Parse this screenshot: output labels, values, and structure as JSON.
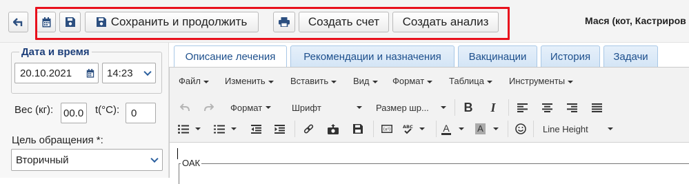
{
  "toolbar": {
    "save_continue_label": "Сохранить и продолжить",
    "create_invoice_label": "Создать счет",
    "create_analysis_label": "Создать анализ",
    "patient_label": "Мася (кот, Кастриров"
  },
  "datetime": {
    "legend": "Дата и время",
    "date_value": "20.10.2021",
    "time_value": "14:23"
  },
  "measures": {
    "weight_label": "Вес (кг):",
    "weight_value": "00.0",
    "temp_label": "t(°C):",
    "temp_value": "0"
  },
  "purpose": {
    "label": "Цель обращения *:",
    "value": "Вторичный"
  },
  "tabs": [
    {
      "label": "Описание лечения",
      "active": true
    },
    {
      "label": "Рекомендации и назначения",
      "active": false
    },
    {
      "label": "Вакцинации",
      "active": false
    },
    {
      "label": "История",
      "active": false
    },
    {
      "label": "Задачи",
      "active": false
    }
  ],
  "editor_menu": [
    "Файл",
    "Изменить",
    "Вставить",
    "Вид",
    "Формат",
    "Таблица",
    "Инструменты"
  ],
  "editor_toolbar": {
    "format_label": "Формат",
    "font_label": "Шрифт",
    "size_label": "Размер шр...",
    "line_height_label": "Line Height",
    "bold_glyph": "B",
    "italic_glyph": "I",
    "font_color_glyph": "A",
    "bg_color_glyph": "A"
  },
  "content": {
    "fieldset_legend": "ОАК"
  },
  "colors": {
    "highlight": "#e8101c",
    "accent": "#1d4f8c",
    "tab_bg": "#d4e5f6"
  }
}
